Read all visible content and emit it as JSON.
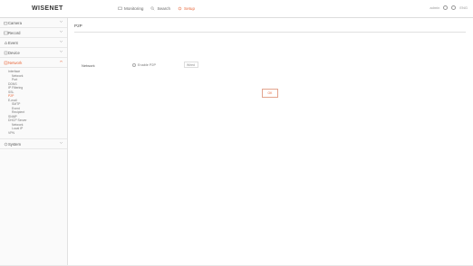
{
  "brand": {
    "logo": "WISENET"
  },
  "topnav": {
    "items": [
      {
        "label": "Monitoring",
        "icon": "monitor-icon",
        "active": false
      },
      {
        "label": "Search",
        "icon": "search-icon",
        "active": false
      },
      {
        "label": "Setup",
        "icon": "setup-icon",
        "active": true
      }
    ]
  },
  "topright": {
    "user_text": "admin",
    "lang": "ENG"
  },
  "sidebar": {
    "menus": [
      {
        "label": "Camera",
        "icon": "camera-icon"
      },
      {
        "label": "Record",
        "icon": "record-icon"
      },
      {
        "label": "Event",
        "icon": "event-icon"
      },
      {
        "label": "Device",
        "icon": "device-icon"
      },
      {
        "label": "Network",
        "icon": "network-icon",
        "active": true
      }
    ],
    "network_sub": {
      "interface": "Interface",
      "interface_items": [
        "Network",
        "Port"
      ],
      "ddns": "DDNS",
      "ip_filtering": "IP Filtering",
      "ssl": "SSL",
      "p2p": "P2P",
      "email": "E-mail",
      "email_items": [
        "SMTP",
        "Event",
        "Recipient"
      ],
      "snmp": "SNMP",
      "dhcp": "DHCP Server",
      "dhcp_items": [
        "Network",
        "Local IP"
      ],
      "vpn": "VPN"
    },
    "system": {
      "label": "System",
      "icon": "system-icon"
    }
  },
  "main": {
    "title": "P2P",
    "setting_label": "Network",
    "checkbox_label": "Enable P2P",
    "select_value": "Wired",
    "ok_label": "OK"
  },
  "colors": {
    "accent": "#e8673a"
  }
}
